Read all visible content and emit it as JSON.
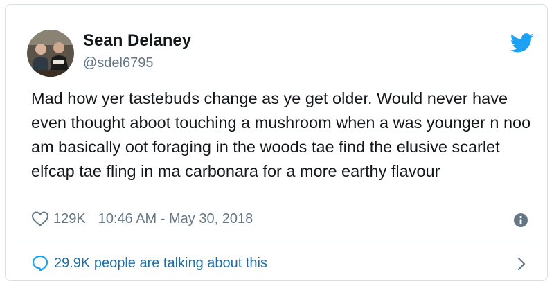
{
  "tweet": {
    "author_name": "Sean Delaney",
    "author_handle": "@sdel6795",
    "text": "Mad how yer tastebuds change as ye get older. Would never have even thought aboot touching a mushroom when a was younger n noo am basically oot foraging in the woods tae find the elusive scarlet elfcap tae fling in ma carbonara for a more earthy flavour",
    "like_count": "129K",
    "timestamp": "10:46 AM - May 30, 2018",
    "talking_about": "29.9K people are talking about this"
  },
  "icons": {
    "brand": "twitter-bird-icon",
    "like": "heart-icon",
    "info": "info-icon",
    "reply": "speech-bubble-icon",
    "expand": "chevron-right-icon"
  },
  "colors": {
    "twitter_blue": "#1da1f2",
    "link_blue": "#1b6ea8",
    "text": "#14171a",
    "secondary_text": "#657786",
    "border": "#d8dfe5"
  }
}
